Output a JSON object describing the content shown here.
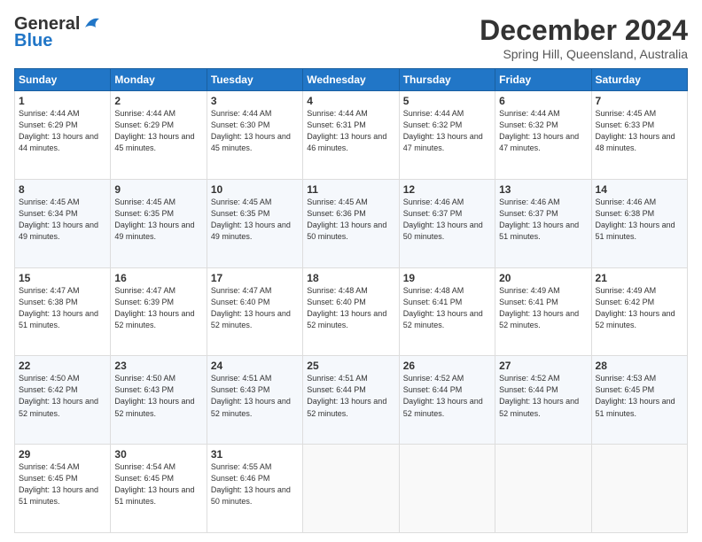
{
  "logo": {
    "line1": "General",
    "line2": "Blue"
  },
  "title": "December 2024",
  "subtitle": "Spring Hill, Queensland, Australia",
  "headers": [
    "Sunday",
    "Monday",
    "Tuesday",
    "Wednesday",
    "Thursday",
    "Friday",
    "Saturday"
  ],
  "weeks": [
    [
      {
        "day": "1",
        "sunrise": "4:44 AM",
        "sunset": "6:29 PM",
        "daylight": "13 hours and 44 minutes."
      },
      {
        "day": "2",
        "sunrise": "4:44 AM",
        "sunset": "6:29 PM",
        "daylight": "13 hours and 45 minutes."
      },
      {
        "day": "3",
        "sunrise": "4:44 AM",
        "sunset": "6:30 PM",
        "daylight": "13 hours and 45 minutes."
      },
      {
        "day": "4",
        "sunrise": "4:44 AM",
        "sunset": "6:31 PM",
        "daylight": "13 hours and 46 minutes."
      },
      {
        "day": "5",
        "sunrise": "4:44 AM",
        "sunset": "6:32 PM",
        "daylight": "13 hours and 47 minutes."
      },
      {
        "day": "6",
        "sunrise": "4:44 AM",
        "sunset": "6:32 PM",
        "daylight": "13 hours and 47 minutes."
      },
      {
        "day": "7",
        "sunrise": "4:45 AM",
        "sunset": "6:33 PM",
        "daylight": "13 hours and 48 minutes."
      }
    ],
    [
      {
        "day": "8",
        "sunrise": "4:45 AM",
        "sunset": "6:34 PM",
        "daylight": "13 hours and 49 minutes."
      },
      {
        "day": "9",
        "sunrise": "4:45 AM",
        "sunset": "6:35 PM",
        "daylight": "13 hours and 49 minutes."
      },
      {
        "day": "10",
        "sunrise": "4:45 AM",
        "sunset": "6:35 PM",
        "daylight": "13 hours and 49 minutes."
      },
      {
        "day": "11",
        "sunrise": "4:45 AM",
        "sunset": "6:36 PM",
        "daylight": "13 hours and 50 minutes."
      },
      {
        "day": "12",
        "sunrise": "4:46 AM",
        "sunset": "6:37 PM",
        "daylight": "13 hours and 50 minutes."
      },
      {
        "day": "13",
        "sunrise": "4:46 AM",
        "sunset": "6:37 PM",
        "daylight": "13 hours and 51 minutes."
      },
      {
        "day": "14",
        "sunrise": "4:46 AM",
        "sunset": "6:38 PM",
        "daylight": "13 hours and 51 minutes."
      }
    ],
    [
      {
        "day": "15",
        "sunrise": "4:47 AM",
        "sunset": "6:38 PM",
        "daylight": "13 hours and 51 minutes."
      },
      {
        "day": "16",
        "sunrise": "4:47 AM",
        "sunset": "6:39 PM",
        "daylight": "13 hours and 52 minutes."
      },
      {
        "day": "17",
        "sunrise": "4:47 AM",
        "sunset": "6:40 PM",
        "daylight": "13 hours and 52 minutes."
      },
      {
        "day": "18",
        "sunrise": "4:48 AM",
        "sunset": "6:40 PM",
        "daylight": "13 hours and 52 minutes."
      },
      {
        "day": "19",
        "sunrise": "4:48 AM",
        "sunset": "6:41 PM",
        "daylight": "13 hours and 52 minutes."
      },
      {
        "day": "20",
        "sunrise": "4:49 AM",
        "sunset": "6:41 PM",
        "daylight": "13 hours and 52 minutes."
      },
      {
        "day": "21",
        "sunrise": "4:49 AM",
        "sunset": "6:42 PM",
        "daylight": "13 hours and 52 minutes."
      }
    ],
    [
      {
        "day": "22",
        "sunrise": "4:50 AM",
        "sunset": "6:42 PM",
        "daylight": "13 hours and 52 minutes."
      },
      {
        "day": "23",
        "sunrise": "4:50 AM",
        "sunset": "6:43 PM",
        "daylight": "13 hours and 52 minutes."
      },
      {
        "day": "24",
        "sunrise": "4:51 AM",
        "sunset": "6:43 PM",
        "daylight": "13 hours and 52 minutes."
      },
      {
        "day": "25",
        "sunrise": "4:51 AM",
        "sunset": "6:44 PM",
        "daylight": "13 hours and 52 minutes."
      },
      {
        "day": "26",
        "sunrise": "4:52 AM",
        "sunset": "6:44 PM",
        "daylight": "13 hours and 52 minutes."
      },
      {
        "day": "27",
        "sunrise": "4:52 AM",
        "sunset": "6:44 PM",
        "daylight": "13 hours and 52 minutes."
      },
      {
        "day": "28",
        "sunrise": "4:53 AM",
        "sunset": "6:45 PM",
        "daylight": "13 hours and 51 minutes."
      }
    ],
    [
      {
        "day": "29",
        "sunrise": "4:54 AM",
        "sunset": "6:45 PM",
        "daylight": "13 hours and 51 minutes."
      },
      {
        "day": "30",
        "sunrise": "4:54 AM",
        "sunset": "6:45 PM",
        "daylight": "13 hours and 51 minutes."
      },
      {
        "day": "31",
        "sunrise": "4:55 AM",
        "sunset": "6:46 PM",
        "daylight": "13 hours and 50 minutes."
      },
      null,
      null,
      null,
      null
    ]
  ],
  "labels": {
    "sunrise": "Sunrise: ",
    "sunset": "Sunset: ",
    "daylight": "Daylight: "
  }
}
